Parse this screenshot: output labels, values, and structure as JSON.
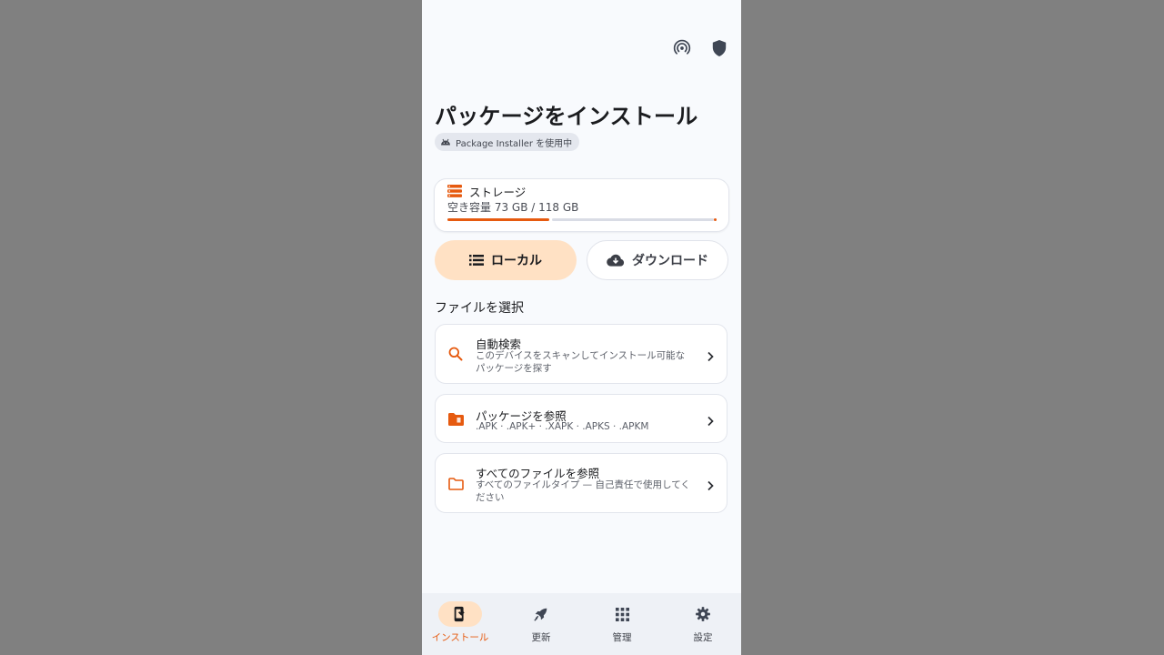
{
  "topbar": {
    "icons": [
      "broadcast-icon",
      "shield-icon"
    ]
  },
  "header": {
    "title": "パッケージをインストール",
    "chip_label": "Package Installer を使用中"
  },
  "storage": {
    "title": "ストレージ",
    "usage_text": "空き容量 73 GB / 118 GB",
    "used_fraction": 0.38,
    "accent": "#e65a0f"
  },
  "source_tabs": {
    "local": "ローカル",
    "download": "ダウンロード",
    "selected": "local"
  },
  "section_label": "ファイルを選択",
  "options": [
    {
      "title": "自動検索",
      "desc": "このデバイスをスキャンしてインストール可能なパッケージを探す",
      "icon": "search-icon"
    },
    {
      "title": "パッケージを参照",
      "desc": ".APK · .APK+ · .XAPK · .APKS · .APKM",
      "icon": "package-folder-icon"
    },
    {
      "title": "すべてのファイルを参照",
      "desc": "すべてのファイルタイプ — 自己責任で使用してください",
      "icon": "folder-icon"
    }
  ],
  "bottom_nav": [
    {
      "label": "インストール",
      "icon": "install-icon",
      "active": true
    },
    {
      "label": "更新",
      "icon": "rocket-icon",
      "active": false
    },
    {
      "label": "管理",
      "icon": "grid-icon",
      "active": false
    },
    {
      "label": "設定",
      "icon": "gear-icon",
      "active": false
    }
  ],
  "colors": {
    "accent": "#e65a0f",
    "selected_bg": "#ffe1c4",
    "background": "#f8fafd"
  }
}
